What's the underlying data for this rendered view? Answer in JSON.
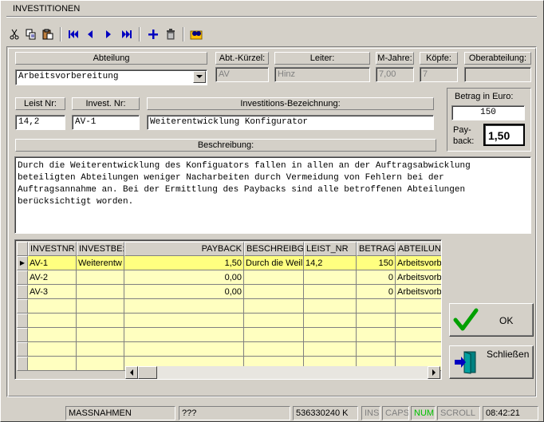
{
  "window": {
    "title": "INVESTITIONEN"
  },
  "toolbar": {
    "icons": [
      "cut-icon",
      "copy-icon",
      "paste-icon",
      "first-record-icon",
      "prior-record-icon",
      "next-record-icon",
      "last-record-icon",
      "add-record-icon",
      "delete-record-icon",
      "find-icon"
    ]
  },
  "header_fields": {
    "abteilung": {
      "label": "Abteilung",
      "value": "Arbeitsvorbereitung"
    },
    "abt_kuerzel": {
      "label": "Abt.-Kürzel:",
      "value": "AV"
    },
    "leiter": {
      "label": "Leiter:",
      "value": "Hinz"
    },
    "m_jahre": {
      "label": "M-Jahre:",
      "value": "7,00"
    },
    "koepfe": {
      "label": "Köpfe:",
      "value": "7"
    },
    "oberabteilung": {
      "label": "Oberabteilung:",
      "value": ""
    }
  },
  "invest_fields": {
    "leist_nr": {
      "label": "Leist Nr:",
      "value": "14,2"
    },
    "invest_nr": {
      "label": "Invest. Nr:",
      "value": "AV-1"
    },
    "bezeichnung": {
      "label": "Investitions-Bezeichnung:",
      "value": "Weiterentwicklung Konfigurator"
    }
  },
  "betrag": {
    "label": "Betrag in Euro:",
    "value": "150",
    "payback_label_1": "Pay-",
    "payback_label_2": "back:",
    "payback_value": "1,50"
  },
  "beschreibung": {
    "label": "Beschreibung:",
    "text": "Durch die Weiterentwicklung des Konfiguators fallen in allen an der Auftragsabwicklung\nbeteiligten Abteilungen weniger Nacharbeiten durch Vermeidung von Fehlern bei der\nAuftragsannahme an. Bei der Ermittlung des Paybacks sind alle betroffenen Abteilungen\nberücksichtigt worden."
  },
  "grid": {
    "columns": [
      "INVESTNR",
      "INVESTBE:",
      "PAYBACK",
      "BESCHREIBG",
      "LEIST_NR",
      "BETRAG",
      "ABTEILUN"
    ],
    "rows": [
      [
        "AV-1",
        "Weiterentw",
        "1,50",
        "Durch die Weil",
        "14,2",
        "150",
        "Arbeitsvorb"
      ],
      [
        "AV-2",
        "",
        "0,00",
        "",
        "",
        "0",
        "Arbeitsvorb"
      ],
      [
        "AV-3",
        "",
        "0,00",
        "",
        "",
        "0",
        "Arbeitsvorb"
      ]
    ],
    "current_row_marker": "▶"
  },
  "buttons": {
    "ok": "OK",
    "close": "Schließen"
  },
  "statusbar": {
    "table": "MASSNAHMEN",
    "info": "???",
    "memory": "536330240 K",
    "ins": "INS",
    "caps": "CAPS",
    "num": "NUM",
    "scroll": "SCROLL",
    "time": "08:42:21"
  },
  "colors": {
    "grid_row": "#ffffc0",
    "grid_selected_row": "#ffff80",
    "num_indicator": "#00c000"
  }
}
